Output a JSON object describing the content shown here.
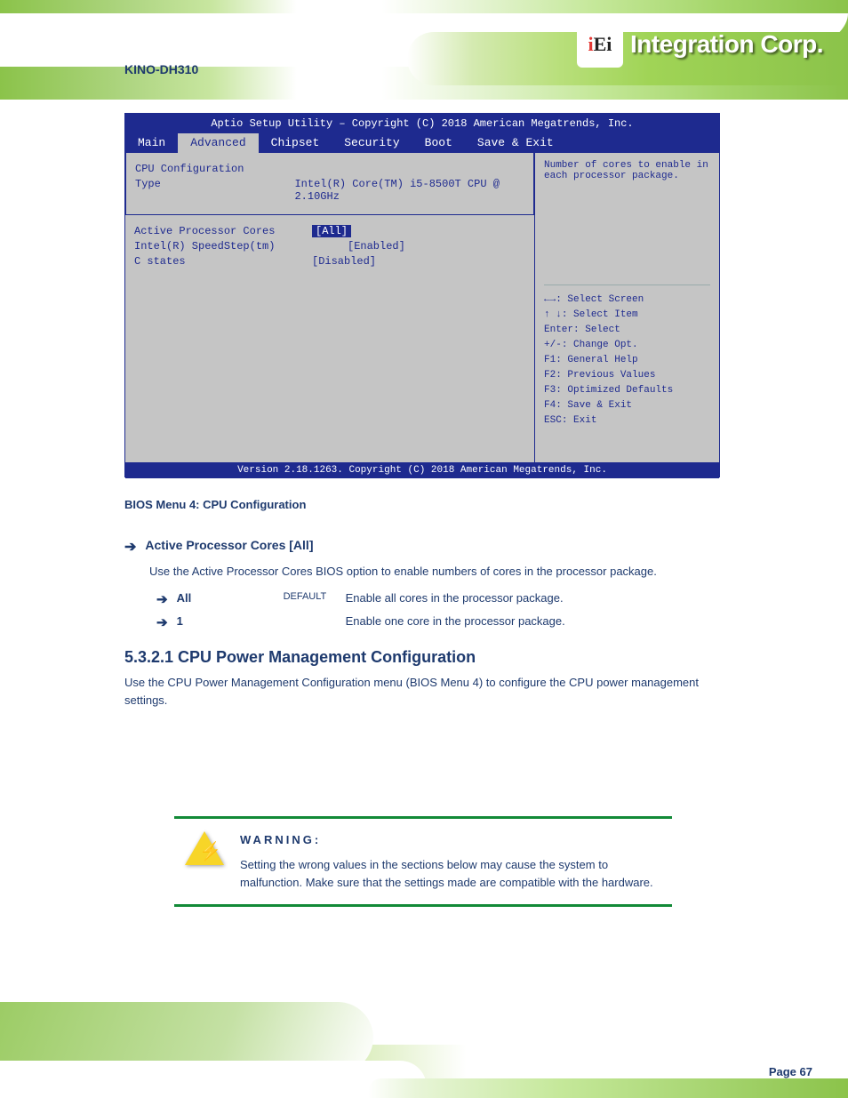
{
  "header": {
    "product": "KINO-DH310",
    "brand": "Integration Corp.",
    "logo": "iEi"
  },
  "bios": {
    "title": "Aptio Setup Utility – Copyright (C) 2018 American Megatrends, Inc.",
    "tabs": [
      "Main",
      "Advanced",
      "Chipset",
      "Security",
      "Boot",
      "Save & Exit"
    ],
    "active": 1,
    "rows": [
      {
        "k": "CPU Configuration",
        "v": ""
      },
      {
        "k": "Type",
        "v": "Intel(R) Core(TM) i5-8500T CPU @ 2.10GHz"
      },
      {
        "k": "Active Processor Cores",
        "v": "[All]"
      },
      {
        "k": "Intel(R) SpeedStep(tm)",
        "v": "[Enabled]"
      },
      {
        "k": "C states",
        "v": "[Disabled]"
      }
    ],
    "help": "Number of cores to enable in each processor package.",
    "keys": [
      {
        "k": "←→",
        "v": ": Select Screen"
      },
      {
        "k": "↑ ↓",
        "v": ": Select Item"
      },
      {
        "k": "Enter",
        "v": ": Select"
      },
      {
        "k": "+/-",
        "v": ": Change Opt."
      },
      {
        "k": "F1",
        "v": ": General Help"
      },
      {
        "k": "F2",
        "v": ": Previous Values"
      },
      {
        "k": "F3",
        "v": ": Optimized Defaults"
      },
      {
        "k": "F4",
        "v": ": Save & Exit"
      },
      {
        "k": "ESC",
        "v": ": Exit"
      }
    ],
    "footer": "Version 2.18.1263. Copyright (C) 2018 American Megatrends, Inc."
  },
  "caption": "BIOS Menu 4: CPU Configuration",
  "opt": {
    "name": "Active Processor Cores [All]",
    "desc": "Use the Active Processor Cores BIOS option to enable numbers of cores in the processor package.",
    "sub": [
      {
        "k": "All",
        "def": "DEFAULT",
        "txt": "Enable all cores in the processor package."
      },
      {
        "k": "1",
        "def": "",
        "txt": "Enable one core in the processor package."
      }
    ]
  },
  "section": {
    "num": "5.3.2.1 CPU Power Management Configuration",
    "desc": "Use the CPU Power Management Configuration menu (BIOS Menu 4) to configure the CPU power management settings."
  },
  "warn": {
    "title": "WARNING:",
    "body": "Setting the wrong values in the sections below may cause the system to malfunction. Make sure that the settings made are compatible with the hardware."
  },
  "page": "Page 67"
}
